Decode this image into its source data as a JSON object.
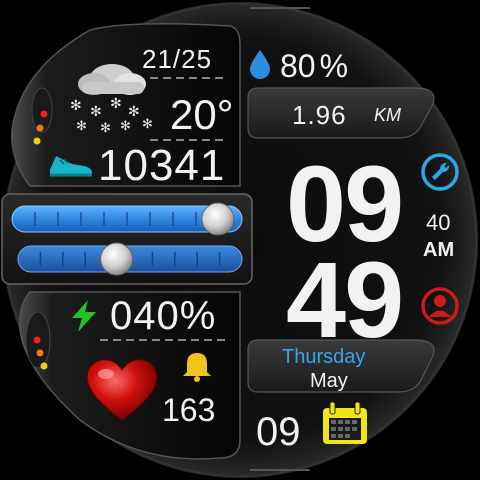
{
  "colors": {
    "accent_blue": "#2a8fe0",
    "slider_blue": "#2f86e0",
    "day_blue": "#3aa3e8",
    "battery_green": "#22c22a",
    "bell_yellow": "#f2c31a",
    "calendar_yellow": "#f0e51a",
    "heart_red": "#d01010",
    "alarm_red": "#cc1b1b",
    "shoe_teal": "#19b6c9"
  },
  "weather": {
    "temp_range": "21/25",
    "temperature": "20°",
    "icon": "cloud-snow-icon"
  },
  "humidity": {
    "value": "80",
    "unit": "%",
    "icon": "drop-icon"
  },
  "distance": {
    "value": "1.96",
    "unit": "KM"
  },
  "steps": {
    "value": "10341",
    "icon": "shoe-icon"
  },
  "sliders": {
    "top_level": 0.94,
    "bottom_level": 0.43
  },
  "battery": {
    "value": "040%",
    "icon": "bolt-icon"
  },
  "heart": {
    "icon": "heart-icon"
  },
  "notifications": {
    "value": "163",
    "icon": "bell-icon"
  },
  "time": {
    "hours": "09",
    "minutes": "49",
    "seconds": "40",
    "ampm": "AM"
  },
  "date": {
    "weekday": "Thursday",
    "month": "May",
    "day": "09",
    "icon": "calendar-icon"
  },
  "shortcuts": {
    "settings_icon": "wrench-icon",
    "profile_icon": "user-icon"
  }
}
